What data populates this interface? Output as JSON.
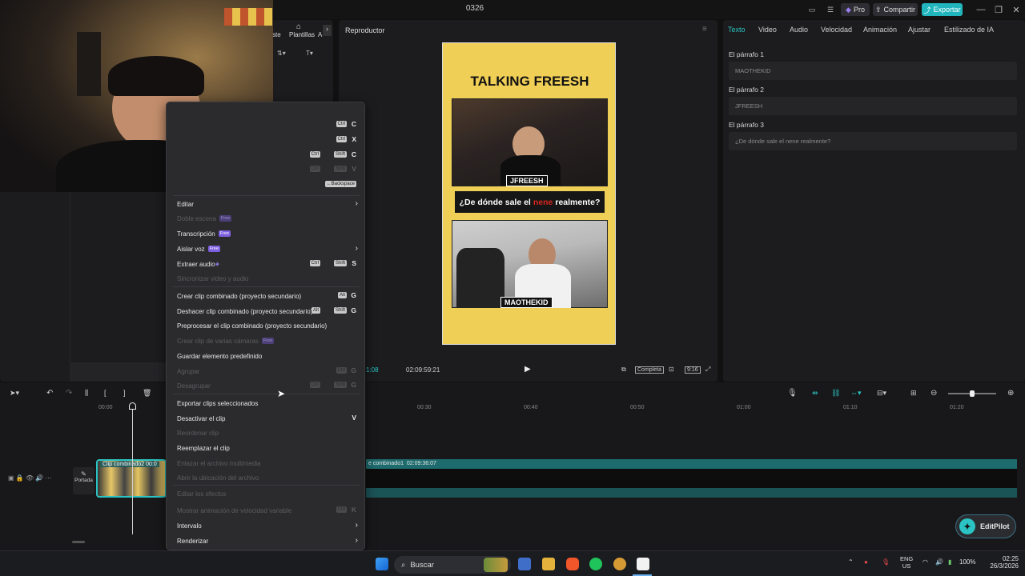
{
  "window": {
    "title": "0326",
    "pro_label": "Pro",
    "share_label": "Compartir",
    "export_label": "Exportar"
  },
  "left_panel": {
    "tab_partial": "ste",
    "tab_templates": "Plantillas",
    "tab_partial2": "A"
  },
  "player": {
    "title": "Reproductor",
    "video_title": "TALKING FREESH",
    "tag_top": "JFREESH",
    "question_prefix": "¿De dónde sale el",
    "question_highlight": "nene",
    "question_suffix": "realmente?",
    "tag_bottom": "MAOTHEKID",
    "time_current_partial": "1:08",
    "time_total": "02:09:59:21",
    "quality_label": "Completa",
    "ratio_label": "9:16"
  },
  "inspector": {
    "tabs": [
      "Texto",
      "Video",
      "Audio",
      "Velocidad",
      "Animación",
      "Ajustar",
      "Estilizado de IA"
    ],
    "active_tab": "Texto",
    "paragraphs": [
      {
        "label": "El párrafo 1",
        "value": "MAOTHEKID"
      },
      {
        "label": "El párrafo 2",
        "value": "JFREESH"
      },
      {
        "label": "El párrafo 3",
        "value": "¿De dónde sale el nene realmente?"
      }
    ]
  },
  "timeline": {
    "ruler": [
      "00:00",
      "00:30",
      "00:40",
      "00:50",
      "01:00",
      "01:10",
      "01:20"
    ],
    "cover_label": "Portada",
    "clip_label": "Clip combinado2",
    "clip_time_partial": "00:0",
    "track_label": "e combinado1",
    "track_duration": "02:09:36:07",
    "editpilot_label": "EditPilot"
  },
  "context_menu": {
    "shortcut_rows": [
      {
        "keys": [
          "Ctrl"
        ],
        "key": "C",
        "enabled": true
      },
      {
        "keys": [
          "Ctrl"
        ],
        "key": "X",
        "enabled": true
      },
      {
        "keys": [
          "Ctrl",
          "Shift"
        ],
        "key": "C",
        "enabled": true
      },
      {
        "keys": [
          "Ctrl",
          "Shift"
        ],
        "key": "V",
        "enabled": false
      },
      {
        "keys": [
          "←Backspace"
        ],
        "key": "",
        "enabled": true
      }
    ],
    "items": [
      {
        "label": "Editar",
        "enabled": true,
        "submenu": true
      },
      {
        "label": "Doble escena",
        "enabled": false,
        "badge": "Free"
      },
      {
        "label": "Transcripción",
        "enabled": true,
        "badge": "Free"
      },
      {
        "label": "Aislar voz",
        "enabled": true,
        "badge": "Free",
        "submenu": true
      },
      {
        "label": "Extraer audio",
        "enabled": true,
        "shortcut": [
          "Ctrl",
          "Shift"
        ],
        "key": "S"
      },
      {
        "label": "Sincronizar video y audio",
        "enabled": false
      },
      {
        "label": "Crear clip combinado (proyecto secundario)",
        "enabled": true,
        "shortcut": [
          "Alt"
        ],
        "key": "G"
      },
      {
        "label": "Deshacer clip combinado (proyecto secundario)",
        "enabled": true,
        "shortcut": [
          "Alt",
          "Shift"
        ],
        "key": "G"
      },
      {
        "label": "Preprocesar el clip combinado (proyecto secundario)",
        "enabled": true
      },
      {
        "label": "Crear clip de varias cámaras",
        "enabled": false,
        "badge": "Free"
      },
      {
        "label": "Guardar elemento predefinido",
        "enabled": true
      },
      {
        "label": "Agrupar",
        "enabled": false,
        "shortcut": [
          "Ctrl"
        ],
        "key": "G"
      },
      {
        "label": "Desagrupar",
        "enabled": false,
        "shortcut": [
          "Ctrl",
          "Shift"
        ],
        "key": "G"
      },
      {
        "label": "Exportar clips seleccionados",
        "enabled": true
      },
      {
        "label": "Desactivar el clip",
        "enabled": true,
        "key": "V"
      },
      {
        "label": "Reordenar clip",
        "enabled": false
      },
      {
        "label": "Reemplazar el clip",
        "enabled": true
      },
      {
        "label": "Enlazar el archivo multimedia",
        "enabled": false
      },
      {
        "label": "Abrir la ubicación del archivo",
        "enabled": false
      },
      {
        "label": "Editar los efectos",
        "enabled": false
      },
      {
        "label": "Mostrar animación de velocidad variable",
        "enabled": false,
        "shortcut": [
          "Ctrl"
        ],
        "key": "K"
      },
      {
        "label": "Intervalo",
        "enabled": true,
        "submenu": true
      },
      {
        "label": "Renderizar",
        "enabled": true,
        "submenu": true
      }
    ]
  },
  "taskbar": {
    "search_placeholder": "Buscar",
    "lang_top": "ENG",
    "lang_bottom": "US",
    "battery": "100%",
    "time": "02:25",
    "date": "26/3/2026"
  }
}
